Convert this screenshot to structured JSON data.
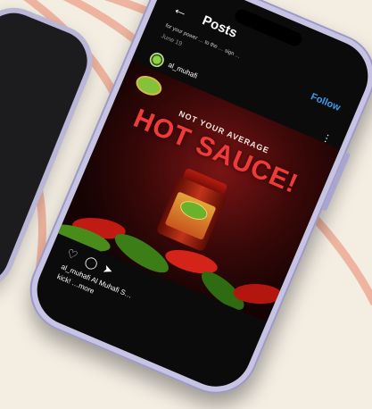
{
  "header": {
    "title": "Posts",
    "back_icon": "arrow-left-icon"
  },
  "post": {
    "caption_preview": "for your power … to the … sign …",
    "date": "June 19",
    "follow_label": "Follow",
    "username": "al_muhafi",
    "image": {
      "tagline": "NOT YOUR AVERAGE",
      "headline": "HOT SAUCE!"
    },
    "caption_line1": "al_muhafi Al Muhafi S…",
    "caption_line2": "kick! …more"
  },
  "colors": {
    "accent": "#3d9cf2",
    "headline": "#f03a3a",
    "background": "#f3ede2",
    "phone_frame": "#c6c3e3"
  }
}
